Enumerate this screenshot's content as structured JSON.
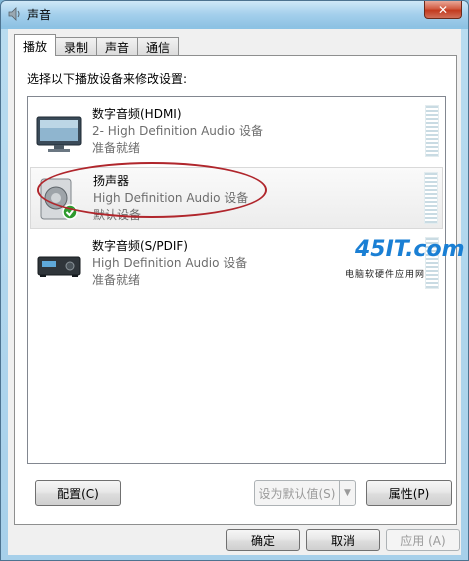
{
  "window": {
    "title": "声音",
    "close_label": "✕"
  },
  "tabs": [
    {
      "label": "播放",
      "active": true
    },
    {
      "label": "录制",
      "active": false
    },
    {
      "label": "声音",
      "active": false
    },
    {
      "label": "通信",
      "active": false
    }
  ],
  "panel": {
    "instruction": "选择以下播放设备来修改设置:"
  },
  "devices": [
    {
      "name": "数字音频(HDMI)",
      "description": "2- High Definition Audio 设备",
      "status": "准备就绪",
      "icon": "monitor-icon",
      "selected": false,
      "default": false
    },
    {
      "name": "扬声器",
      "description": "High Definition Audio 设备",
      "status": "默认设备",
      "icon": "speaker-icon",
      "selected": true,
      "default": true
    },
    {
      "name": "数字音频(S/PDIF)",
      "description": "High Definition Audio 设备",
      "status": "准备就绪",
      "icon": "digital-receiver-icon",
      "selected": false,
      "default": false
    }
  ],
  "buttons": {
    "configure": "配置(C)",
    "set_default": "设为默认值(S)",
    "properties": "属性(P)",
    "ok": "确定",
    "cancel": "取消",
    "apply": "应用 (A)"
  },
  "watermark": {
    "brand": "45IT.com",
    "subtitle": "电脑软硬件应用网"
  },
  "colors": {
    "highlight": "#b0262c",
    "default_check": "#2e9a2e",
    "watermark_blue": "#1a7fd4"
  }
}
